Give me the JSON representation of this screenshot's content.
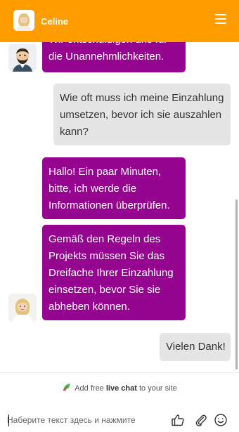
{
  "header": {
    "title": "Celine"
  },
  "messages": [
    {
      "from": "agent",
      "lines": [
        "Wir entschuldigen uns für",
        "die Unannehmlichkeiten."
      ]
    },
    {
      "from": "user",
      "lines": [
        "Wie oft muss ich meine Einzahlung",
        "umsetzen, bevor ich sie auszahlen",
        "kann?"
      ]
    },
    {
      "from": "agent",
      "lines": [
        "Hallo! Ein paar Minuten,",
        "bitte, ich werde die",
        "Informationen überprüfen."
      ]
    },
    {
      "from": "agent",
      "lines": [
        "Gemäß den Regeln des",
        "Projekts müssen Sie das",
        "Dreifache Ihrer Einzahlung",
        "einsetzen, bevor Sie sie",
        "abheben können."
      ]
    },
    {
      "from": "user",
      "lines": [
        "Vielen Dank!"
      ]
    }
  ],
  "promo": {
    "prefix": "Add free",
    "link": "live chat",
    "suffix": "to your site"
  },
  "composer": {
    "placeholder": "Наберите текст здесь и нажмите"
  },
  "icons": [
    "menu-icon",
    "thumbs-up-icon",
    "paperclip-icon",
    "smiley-icon",
    "leaf-icon"
  ],
  "colors": {
    "header": "#ff9d00",
    "agent_bubble": "#950590",
    "user_bubble": "#e5e5e5"
  }
}
